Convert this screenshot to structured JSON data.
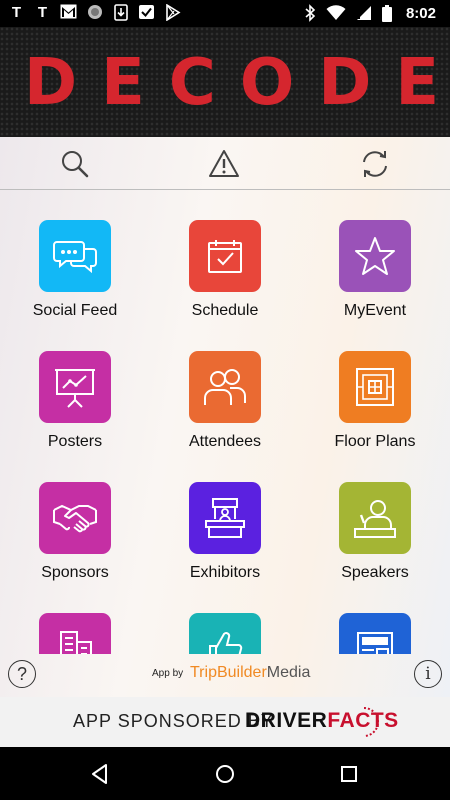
{
  "status_bar": {
    "left_icons": [
      "T",
      "T",
      "gmail-icon",
      "circle-icon",
      "download-icon",
      "check-icon",
      "play-store-icon"
    ],
    "time": "8:02"
  },
  "banner": {
    "title": "DECODE"
  },
  "toolbar": {
    "icons": [
      "search-icon",
      "alert-icon",
      "refresh-icon"
    ]
  },
  "tiles": [
    {
      "label": "Social Feed",
      "icon": "chat-bubbles-icon",
      "color": "#12b8f6"
    },
    {
      "label": "Schedule",
      "icon": "calendar-icon",
      "color": "#e8463a"
    },
    {
      "label": "MyEvent",
      "icon": "star-icon",
      "color": "#9a52b8"
    },
    {
      "label": "Posters",
      "icon": "presentation-icon",
      "color": "#c52fa4"
    },
    {
      "label": "Attendees",
      "icon": "people-icon",
      "color": "#ea6a32"
    },
    {
      "label": "Floor Plans",
      "icon": "floor-plan-icon",
      "color": "#ef7d22"
    },
    {
      "label": "Sponsors",
      "icon": "handshake-icon",
      "color": "#c52fa4"
    },
    {
      "label": "Exhibitors",
      "icon": "booth-icon",
      "color": "#5b21e0"
    },
    {
      "label": "Speakers",
      "icon": "speaker-icon",
      "color": "#a4b534"
    },
    {
      "label": "",
      "icon": "buildings-icon",
      "color": "#c52fa4"
    },
    {
      "label": "",
      "icon": "thumbs-up-icon",
      "color": "#19b3b5"
    },
    {
      "label": "",
      "icon": "news-icon",
      "color": "#1f63d6"
    }
  ],
  "footer": {
    "help": "?",
    "app_by": "App by",
    "brand_trip": "TripBuilder",
    "brand_media": "Media",
    "info": "i"
  },
  "sponsor": {
    "text": "APP SPONSORED BY",
    "brand_driver": "DRIVER",
    "brand_facts": "FACTS"
  },
  "nav": {
    "icons": [
      "back-icon",
      "home-icon",
      "recents-icon"
    ]
  }
}
